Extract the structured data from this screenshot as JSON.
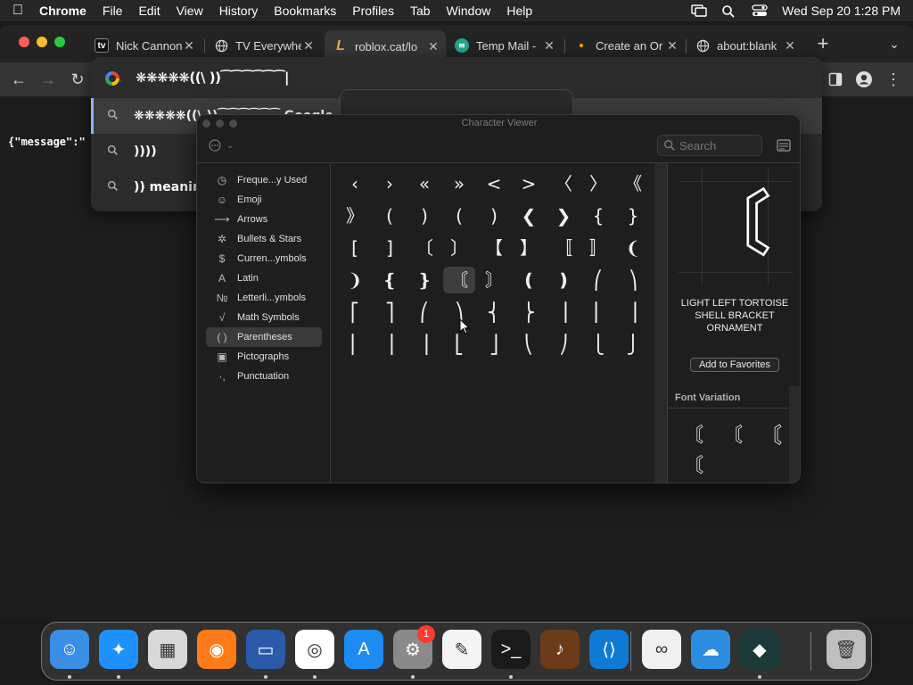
{
  "menubar": {
    "app": "Chrome",
    "items": [
      "File",
      "Edit",
      "View",
      "History",
      "Bookmarks",
      "Profiles",
      "Tab",
      "Window",
      "Help"
    ],
    "clock": "Wed Sep 20  1:28 PM"
  },
  "tabs": [
    {
      "title": "Nick Cannon",
      "favicon": "tv-icon"
    },
    {
      "title": "TV Everywhe",
      "favicon": "globe-icon"
    },
    {
      "title": "roblox.cat/lo",
      "favicon": "l-icon"
    },
    {
      "title": "Temp Mail -",
      "favicon": "temp-mail-icon"
    },
    {
      "title": "Create an Or",
      "favicon": "dot-icon"
    },
    {
      "title": "about:blank",
      "favicon": "globe-icon"
    }
  ],
  "omnibox": {
    "input": "❋❋❋❋❋((\\  ))⁀⁀⁀⁀⁀⁀|",
    "suggestions": [
      {
        "text": "❋❋❋❋❋((\\  ))⁀⁀⁀⁀⁀⁀  Google",
        "icon": "search-icon"
      },
      {
        "text": "))))",
        "icon": "search-icon"
      },
      {
        "text": ")) meanin",
        "icon": "search-icon"
      }
    ]
  },
  "page": {
    "json_text": "{\"message\":\""
  },
  "character_viewer": {
    "title": "Character Viewer",
    "search_placeholder": "Search",
    "categories": [
      {
        "label": "Freque...y Used",
        "icon": "clock-icon"
      },
      {
        "label": "Emoji",
        "icon": "smiley-icon"
      },
      {
        "label": "Arrows",
        "icon": "arrow-icon"
      },
      {
        "label": "Bullets & Stars",
        "icon": "star-icon"
      },
      {
        "label": "Curren...ymbols",
        "icon": "dollar-icon"
      },
      {
        "label": "Latin",
        "icon": "latin-a-icon"
      },
      {
        "label": "Letterli...ymbols",
        "icon": "numero-icon"
      },
      {
        "label": "Math Symbols",
        "icon": "sqrt-icon"
      },
      {
        "label": "Parentheses",
        "icon": "parens-icon",
        "selected": true
      },
      {
        "label": "Pictographs",
        "icon": "pictograph-icon"
      },
      {
        "label": "Punctuation",
        "icon": "punctuation-icon"
      }
    ],
    "characters": [
      [
        "‹",
        "›",
        "«",
        "»",
        "<",
        ">",
        "〈",
        "〉",
        "《"
      ],
      [
        "》",
        "(",
        ")",
        "(",
        ")",
        "❮",
        "❯",
        "{",
        "}"
      ],
      [
        "[",
        "]",
        "〔",
        "〕",
        "【",
        "】",
        "〚",
        "〛",
        "❨"
      ],
      [
        "❩",
        "❴",
        "❵",
        "〘",
        "〙",
        "❪",
        "❫",
        "⎛",
        "⎞"
      ],
      [
        "⎡",
        "⎤",
        "⎛",
        "⎞",
        "⎨",
        "⎬",
        "⎟",
        "⎜",
        "⎥"
      ],
      [
        "⎜",
        "⎟",
        "⎥",
        "⎣",
        "⎦",
        "⎝",
        "⎠",
        "⎩",
        "⎭"
      ]
    ],
    "selected_index": [
      3,
      3
    ],
    "detail": {
      "glyph": "〘",
      "name": "LIGHT LEFT TORTOISE SHELL BRACKET ORNAMENT",
      "favorites_button": "Add to Favorites",
      "font_variation_label": "Font Variation",
      "variations": [
        "〘",
        "〘",
        "〘",
        "〘"
      ]
    }
  },
  "dock": [
    {
      "name": "finder-icon",
      "color": "#3a8ee6"
    },
    {
      "name": "safari-icon",
      "color": "#1e90ff"
    },
    {
      "name": "launchpad-icon",
      "color": "#d8d8d8"
    },
    {
      "name": "firefox-icon",
      "color": "#ff7a18"
    },
    {
      "name": "remote-desktop-icon",
      "color": "#2b5aa8"
    },
    {
      "name": "chrome-icon",
      "color": "#ffffff"
    },
    {
      "name": "app-store-icon",
      "color": "#1c8cf2"
    },
    {
      "name": "system-settings-icon",
      "color": "#8a8a8a",
      "badge": "1"
    },
    {
      "name": "textedit-icon",
      "color": "#f4f4f4"
    },
    {
      "name": "terminal-icon",
      "color": "#1a1a1a"
    },
    {
      "name": "garageband-icon",
      "color": "#6b3b1a"
    },
    {
      "name": "vscode-icon",
      "color": "#0d7ad6"
    },
    {
      "name": "visual-studio-icon",
      "color": "#f0f0f0"
    },
    {
      "name": "weather-icon",
      "color": "#2c8de0"
    },
    {
      "name": "filmora-icon",
      "color": "#1a3b3a"
    },
    {
      "name": "trash-icon",
      "color": "#bfbfbf"
    }
  ]
}
